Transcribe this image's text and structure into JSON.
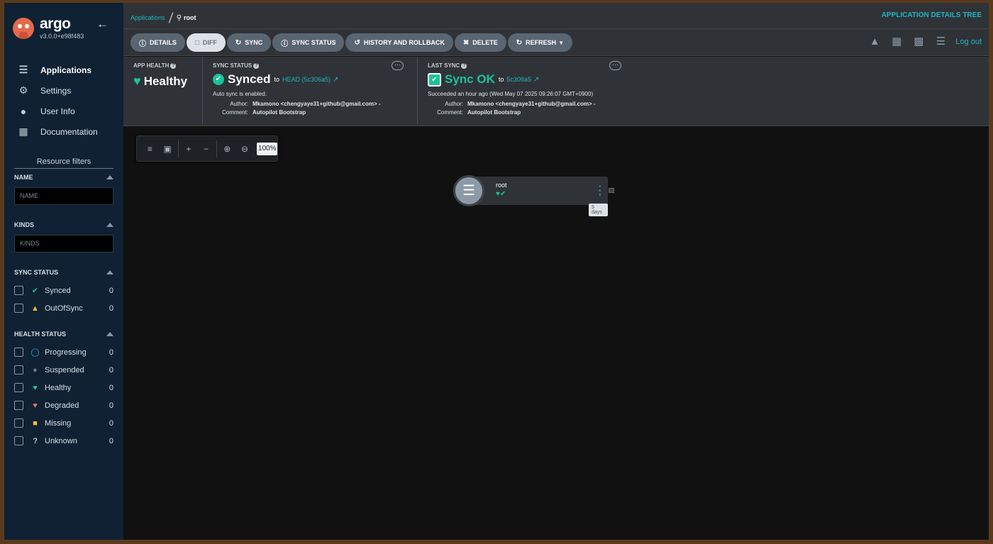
{
  "sidebar": {
    "logo": {
      "name": "argo",
      "version": "v3.0.0+e98f483"
    },
    "nav": [
      {
        "label": "Applications",
        "icon": "layers-icon"
      },
      {
        "label": "Settings",
        "icon": "gear-icon"
      },
      {
        "label": "User Info",
        "icon": "user-icon"
      },
      {
        "label": "Documentation",
        "icon": "book-icon"
      }
    ],
    "resource_filters_title": "Resource filters",
    "name_filter": {
      "label": "NAME",
      "placeholder": "NAME"
    },
    "kinds_filter": {
      "label": "KINDS",
      "placeholder": "KINDS"
    },
    "sync_status": {
      "label": "SYNC STATUS",
      "items": [
        {
          "label": "Synced",
          "count": "0",
          "icon": "synced-icon",
          "color": "#19c39a"
        },
        {
          "label": "OutOfSync",
          "count": "0",
          "icon": "out-of-sync-icon",
          "color": "#f4c030"
        }
      ]
    },
    "health_status": {
      "label": "HEALTH STATUS",
      "items": [
        {
          "label": "Progressing",
          "count": "0",
          "icon": "progressing-icon",
          "color": "#0dadea"
        },
        {
          "label": "Suspended",
          "count": "0",
          "icon": "suspended-icon",
          "color": "#766f94"
        },
        {
          "label": "Healthy",
          "count": "0",
          "icon": "heart-icon",
          "color": "#19c39a"
        },
        {
          "label": "Degraded",
          "count": "0",
          "icon": "broken-heart-icon",
          "color": "#e96d76"
        },
        {
          "label": "Missing",
          "count": "0",
          "icon": "ghost-icon",
          "color": "#f4c030"
        },
        {
          "label": "Unknown",
          "count": "0",
          "icon": "question-icon",
          "color": "#ffffff"
        }
      ]
    }
  },
  "topbar": {
    "breadcrumb_link": "Applications",
    "breadcrumb_current": "root",
    "page_label": "APPLICATION DETAILS TREE"
  },
  "toolbar": {
    "buttons": [
      {
        "label": "DETAILS",
        "icon": "info-icon"
      },
      {
        "label": "DIFF",
        "icon": "file-icon"
      },
      {
        "label": "SYNC",
        "icon": "sync-icon"
      },
      {
        "label": "SYNC STATUS",
        "icon": "info-icon"
      },
      {
        "label": "HISTORY AND ROLLBACK",
        "icon": "history-icon"
      },
      {
        "label": "DELETE",
        "icon": "delete-icon"
      },
      {
        "label": "REFRESH",
        "icon": "refresh-icon"
      }
    ],
    "logout": "Log out"
  },
  "status": {
    "app_health": {
      "label": "APP HEALTH",
      "value": "Healthy"
    },
    "sync_status": {
      "label": "SYNC STATUS",
      "value": "Synced",
      "to": "to",
      "revision": "HEAD (5c306a5)",
      "note": "Auto sync is enabled.",
      "author_label": "Author:",
      "author": "Mkamono <chengyaye31+github@gmail.com> -",
      "comment_label": "Comment:",
      "comment": "Autopilot Bootstrap"
    },
    "last_sync": {
      "label": "LAST SYNC",
      "value": "Sync OK",
      "to": "to",
      "revision": "5c306a5",
      "note": "Succeeded an hour ago (Wed May 07 2025 09:26:07 GMT+0900)",
      "author_label": "Author:",
      "author": "Mkamono <chengyaye31+github@gmail.com> -",
      "comment_label": "Comment:",
      "comment": "Autopilot Bootstrap"
    }
  },
  "graph": {
    "zoom": "100%",
    "node": {
      "name": "root",
      "age": "5 days"
    }
  }
}
